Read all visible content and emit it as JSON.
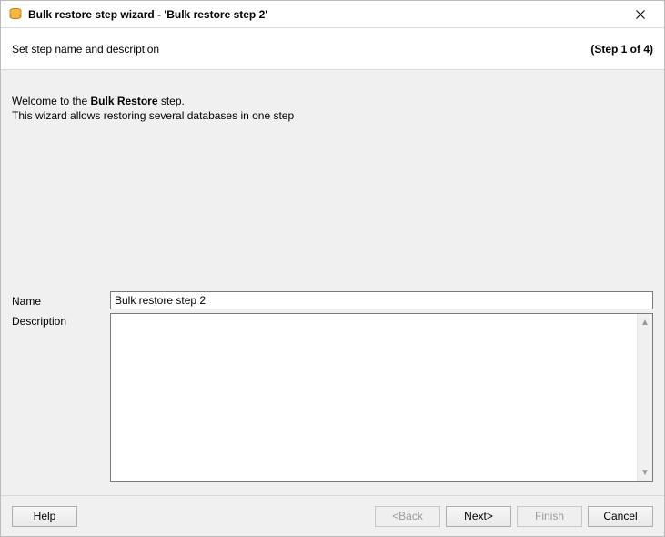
{
  "window": {
    "title": "Bulk restore step wizard - 'Bulk restore step 2'"
  },
  "header": {
    "subtitle": "Set step name and description",
    "step_indicator": "(Step 1 of 4)"
  },
  "welcome": {
    "prefix": "Welcome to the ",
    "bold": "Bulk Restore",
    "suffix": " step.",
    "line2": "This wizard allows restoring several databases in one step"
  },
  "fields": {
    "name_label": "Name",
    "name_value": "Bulk restore step 2",
    "description_label": "Description",
    "description_value": ""
  },
  "buttons": {
    "help": "Help",
    "back": "<Back",
    "next": "Next>",
    "finish": "Finish",
    "cancel": "Cancel"
  }
}
